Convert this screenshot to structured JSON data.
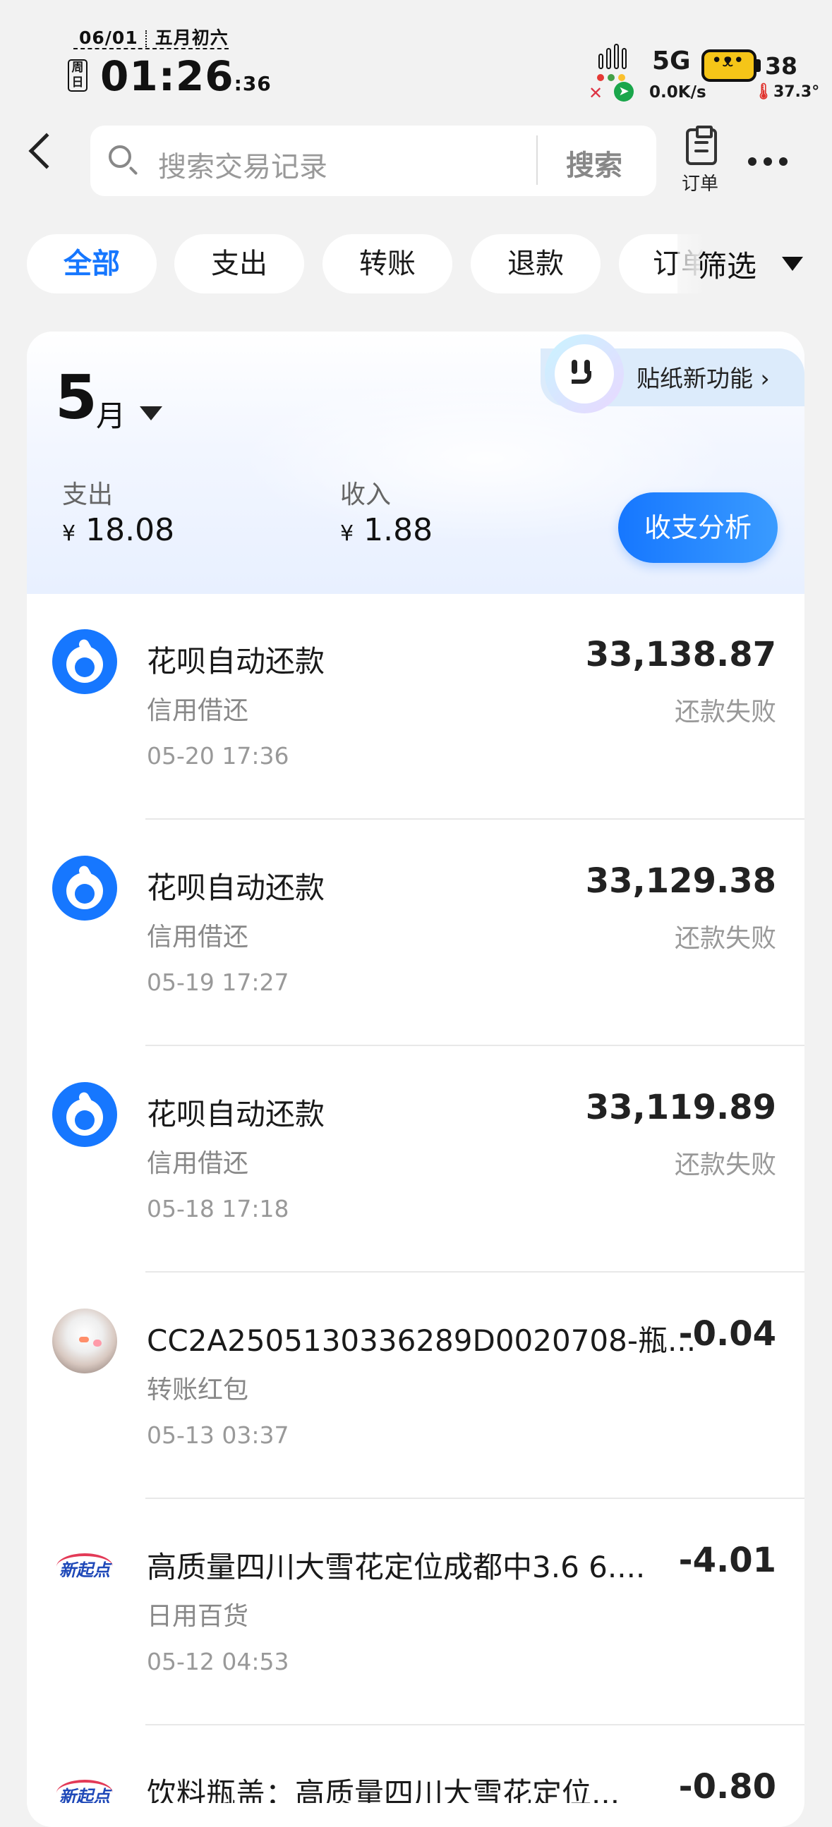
{
  "status_bar": {
    "date": "06/01",
    "lunar": "五月初六",
    "weekday": "周日",
    "time_main": "01:26",
    "time_sec": ":36",
    "network": "5G",
    "speed": "0.0K/s",
    "battery": "38",
    "temperature": "37.3°"
  },
  "header": {
    "search_placeholder": "搜索交易记录",
    "search_button": "搜索",
    "order_label": "订单",
    "icons": [
      "back-arrow-icon",
      "search-icon",
      "order-icon",
      "more-icon"
    ]
  },
  "filters": {
    "chips": [
      "全部",
      "支出",
      "转账",
      "退款",
      "订单"
    ],
    "active": "全部",
    "filter_label": "筛选"
  },
  "month_card": {
    "month": "5",
    "month_unit": "月",
    "sticker_label": "贴纸新功能",
    "expense_label": "支出",
    "expense_value": "18.08",
    "income_label": "收入",
    "income_value": "1.88",
    "currency": "¥",
    "analysis_button": "收支分析"
  },
  "transactions": [
    {
      "icon": "huabei",
      "title": "花呗自动还款",
      "category": "信用借还",
      "date": "05-20 17:36",
      "amount": "33,138.87",
      "status": "还款失败"
    },
    {
      "icon": "huabei",
      "title": "花呗自动还款",
      "category": "信用借还",
      "date": "05-19 17:27",
      "amount": "33,129.38",
      "status": "还款失败"
    },
    {
      "icon": "huabei",
      "title": "花呗自动还款",
      "category": "信用借还",
      "date": "05-18 17:18",
      "amount": "33,119.89",
      "status": "还款失败"
    },
    {
      "icon": "snowman-avatar",
      "title": "CC2A2505130336289D0020708-瓶...",
      "category": "转账红包",
      "date": "05-13 03:37",
      "amount": "-0.04",
      "status": ""
    },
    {
      "icon": "xinqidian-logo",
      "logo_text": "新起点",
      "title": "高质量四川大雪花定位成都中3.6 6....",
      "category": "日用百货",
      "date": "05-12 04:53",
      "amount": "-4.01",
      "status": ""
    },
    {
      "icon": "xinqidian-logo",
      "logo_text": "新起点",
      "title": "饮料瓶盖：高质量四川大雪花定位...",
      "category": "",
      "date": "",
      "amount": "-0.80",
      "status": ""
    }
  ],
  "colors": {
    "accent": "#1677ff",
    "background": "#f2f2f2",
    "card": "#ffffff",
    "muted_text": "#999999"
  }
}
